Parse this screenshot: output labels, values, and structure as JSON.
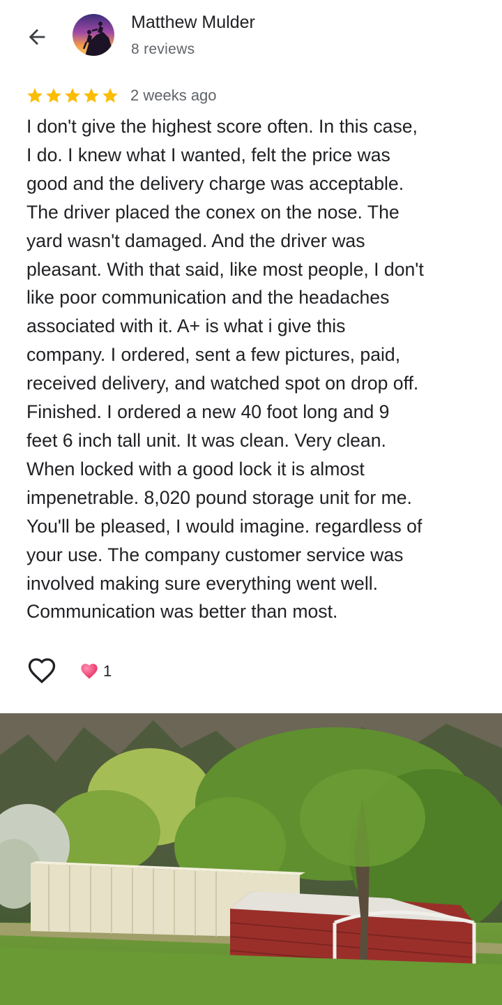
{
  "header": {
    "back_icon": "arrow-back-icon",
    "reviewer_name": "Matthew Mulder",
    "reviewer_meta": "8 reviews"
  },
  "review": {
    "rating": 5,
    "rating_max": 5,
    "star_color": "#fbbc04",
    "date": "2 weeks ago",
    "text": "I don't give the highest score often. In this case,\nI do. I knew what I wanted, felt the price was\ngood and the delivery charge was acceptable.\nThe driver placed the conex on the nose. The\nyard wasn't damaged. And the driver was\npleasant. With that said, like most people, I don't\nlike poor communication and the headaches\nassociated with it. A+ is what i give this\ncompany. I ordered, sent a few pictures, paid,\nreceived delivery, and watched spot on drop off.\nFinished. I ordered a new 40 foot long and 9\nfeet 6 inch tall unit. It was clean. Very clean.\nWhen locked with a good lock it is almost\nimpenetrable. 8,020 pound storage unit for me.\nYou'll be pleased, I would imagine. regardless of\nyour use. The company customer service was\ninvolved making sure everything went well.\nCommunication was better than most."
  },
  "actions": {
    "like_icon": "heart-outline-icon",
    "reaction_icon": "heart-emoji-icon",
    "reaction_count": "1"
  },
  "photo": {
    "icon": "review-photo"
  }
}
